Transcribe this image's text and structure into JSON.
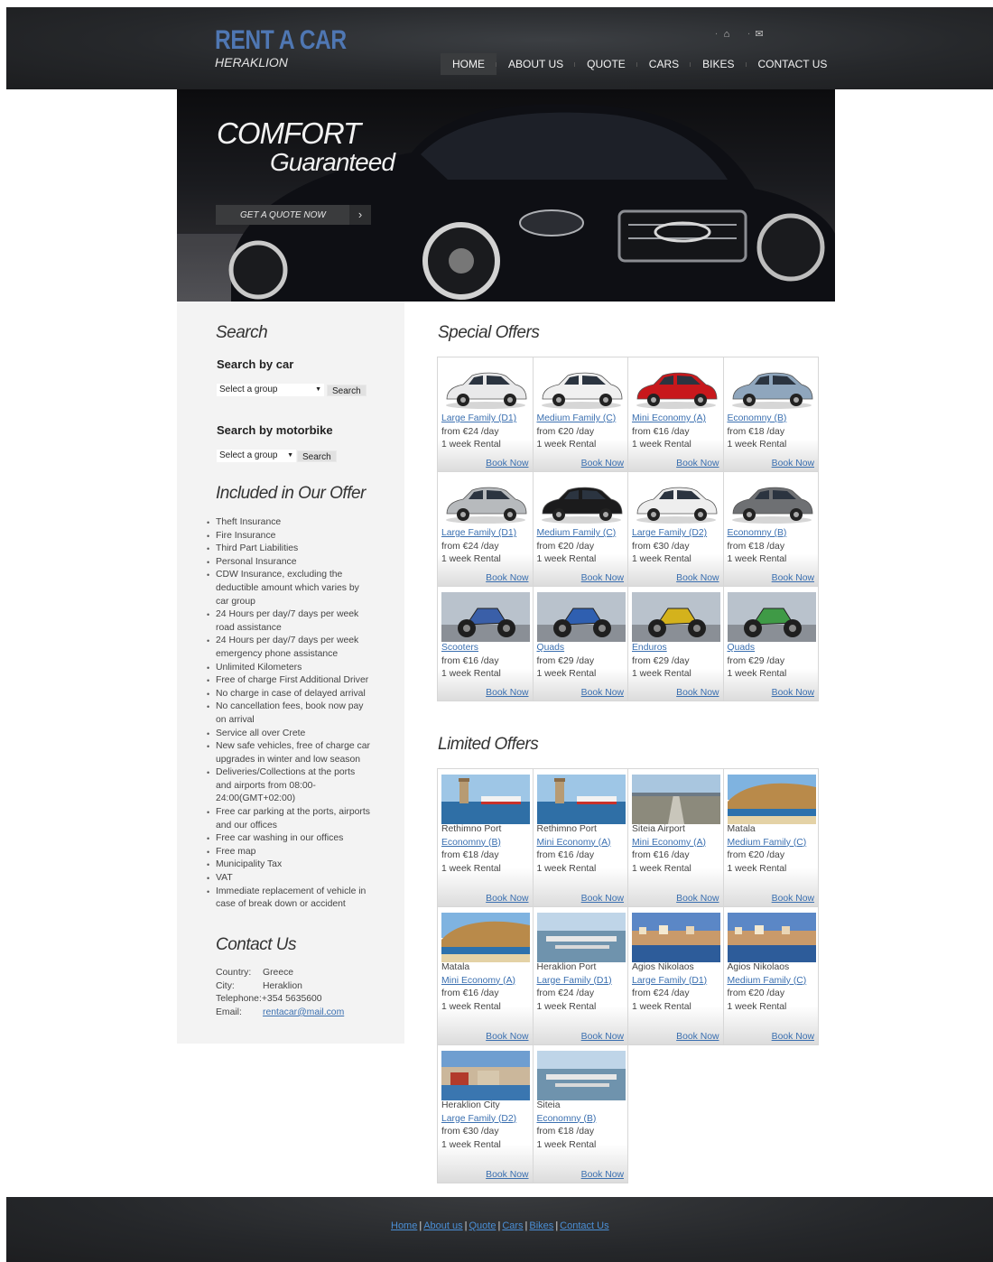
{
  "brand": {
    "title": "RENT A CAR",
    "subtitle": "HERAKLION",
    "accent": "#4f77b3"
  },
  "top_icons": [
    "home-icon",
    "mail-icon"
  ],
  "nav": [
    "HOME",
    "ABOUT US",
    "QUOTE",
    "CARS",
    "BIKES",
    "CONTACT US"
  ],
  "hero": {
    "title": "COMFORT",
    "subtitle": "Guaranteed",
    "cta": "GET A QUOTE NOW",
    "cta_arrow": "›"
  },
  "sidebar": {
    "search_heading": "Search",
    "by_car": {
      "label": "Search by car",
      "select": "Select a group",
      "button": "Search"
    },
    "by_bike": {
      "label": "Search by motorbike",
      "select": "Select a group",
      "button": "Search"
    },
    "included_heading": "Included in Our Offer",
    "included": [
      "Theft Insurance",
      "Fire Insurance",
      "Third Part Liabilities",
      "Personal Insurance",
      "CDW Insurance, excluding the deductible amount which varies by car group",
      "24 Hours per day/7 days per week road assistance",
      "24 Hours per day/7 days per week emergency phone assistance",
      "Unlimited Kilometers",
      "Free of charge First Additional Driver",
      "No charge in case of delayed arrival",
      "No cancellation fees, book now pay on arrival",
      "Service all over Crete",
      "New safe vehicles, free of charge car upgrades in winter and low season",
      "Deliveries/Collections at the ports and airports from 08:00-24:00(GMT+02:00)",
      "Free car parking at the ports, airports and our offices",
      "Free car washing in our offices",
      "Free map",
      "Municipality Tax",
      "VAT",
      "Immediate replacement of vehicle in case of break down or accident"
    ],
    "contact_heading": "Contact Us",
    "contact": {
      "country_k": "Country:",
      "country_v": "Greece",
      "city_k": "City:",
      "city_v": "Heraklion",
      "tel_k": "Telephone:",
      "tel_v": "+354 5635600",
      "email_k": "Email:",
      "email_v": "rentacar@mail.com"
    }
  },
  "special": {
    "heading": "Special Offers",
    "items": [
      {
        "group": "Large Family (D1)",
        "price": "from €24 /day",
        "period": "1 week Rental",
        "book": "Book Now",
        "img": "car",
        "color": "#e9e9ea"
      },
      {
        "group": "Medium Family (C)",
        "price": "from €20 /day",
        "period": "1 week Rental",
        "book": "Book Now",
        "img": "car",
        "color": "#f0f0f0"
      },
      {
        "group": "Mini Economy (A)",
        "price": "from €16 /day",
        "period": "1 week Rental",
        "book": "Book Now",
        "img": "car",
        "color": "#c8181c"
      },
      {
        "group": "Economny (B)",
        "price": "from €18 /day",
        "period": "1 week Rental",
        "book": "Book Now",
        "img": "car",
        "color": "#8fa6bd"
      },
      {
        "group": "Large Family (D1)",
        "price": "from €24 /day",
        "period": "1 week Rental",
        "book": "Book Now",
        "img": "car",
        "color": "#b7babd"
      },
      {
        "group": "Medium Family (C)",
        "price": "from €20 /day",
        "period": "1 week Rental",
        "book": "Book Now",
        "img": "car",
        "color": "#1b1b1c"
      },
      {
        "group": "Large Family (D2)",
        "price": "from €30 /day",
        "period": "1 week Rental",
        "book": "Book Now",
        "img": "car",
        "color": "#eeeeee"
      },
      {
        "group": "Economny (B)",
        "price": "from €18 /day",
        "period": "1 week Rental",
        "book": "Book Now",
        "img": "car",
        "color": "#6e7073"
      },
      {
        "group": "Scooters",
        "price": "from €16 /day",
        "period": "1 week Rental",
        "book": "Book Now",
        "img": "bike",
        "color": "#3a5fa8"
      },
      {
        "group": "Quads",
        "price": "from €29 /day",
        "period": "1 week Rental",
        "book": "Book Now",
        "img": "bike",
        "color": "#2f5fb0"
      },
      {
        "group": "Enduros",
        "price": "from €29 /day",
        "period": "1 week Rental",
        "book": "Book Now",
        "img": "bike",
        "color": "#d4b21c"
      },
      {
        "group": "Quads",
        "price": "from €29 /day",
        "period": "1 week Rental",
        "book": "Book Now",
        "img": "bike",
        "color": "#3f9a46"
      }
    ]
  },
  "limited": {
    "heading": "Limited Offers",
    "items": [
      {
        "location": "Rethimno Port",
        "group": "Economny (B)",
        "price": "from €18 /day",
        "period": "1 week Rental",
        "book": "Book Now",
        "img": "port"
      },
      {
        "location": "Rethimno Port",
        "group": "Mini Economy (A)",
        "price": "from €16 /day",
        "period": "1 week Rental",
        "book": "Book Now",
        "img": "port"
      },
      {
        "location": "Siteia Airport",
        "group": "Mini Economy (A)",
        "price": "from €16 /day",
        "period": "1 week Rental",
        "book": "Book Now",
        "img": "airport"
      },
      {
        "location": "Matala",
        "group": "Medium Family (C)",
        "price": "from €20 /day",
        "period": "1 week Rental",
        "book": "Book Now",
        "img": "beach"
      },
      {
        "location": "Matala",
        "group": "Mini Economy (A)",
        "price": "from €16 /day",
        "period": "1 week Rental",
        "book": "Book Now",
        "img": "beach"
      },
      {
        "location": "Heraklion Port",
        "group": "Large Family (D1)",
        "price": "from €24 /day",
        "period": "1 week Rental",
        "book": "Book Now",
        "img": "harbour"
      },
      {
        "location": "Agios Nikolaos",
        "group": "Large Family (D1)",
        "price": "from €24 /day",
        "period": "1 week Rental",
        "book": "Book Now",
        "img": "town"
      },
      {
        "location": "Agios Nikolaos",
        "group": "Medium Family (C)",
        "price": "from €20 /day",
        "period": "1 week Rental",
        "book": "Book Now",
        "img": "town"
      },
      {
        "location": "Heraklion City",
        "group": "Large Family (D2)",
        "price": "from €30 /day",
        "period": "1 week Rental",
        "book": "Book Now",
        "img": "city"
      },
      {
        "location": "Siteia",
        "group": "Economny (B)",
        "price": "from €18 /day",
        "period": "1 week Rental",
        "book": "Book Now",
        "img": "harbour"
      }
    ]
  },
  "footer": {
    "links": [
      "Home",
      "About us",
      "Quote",
      "Cars",
      "Bikes",
      "Contact Us"
    ],
    "separator": "|"
  }
}
